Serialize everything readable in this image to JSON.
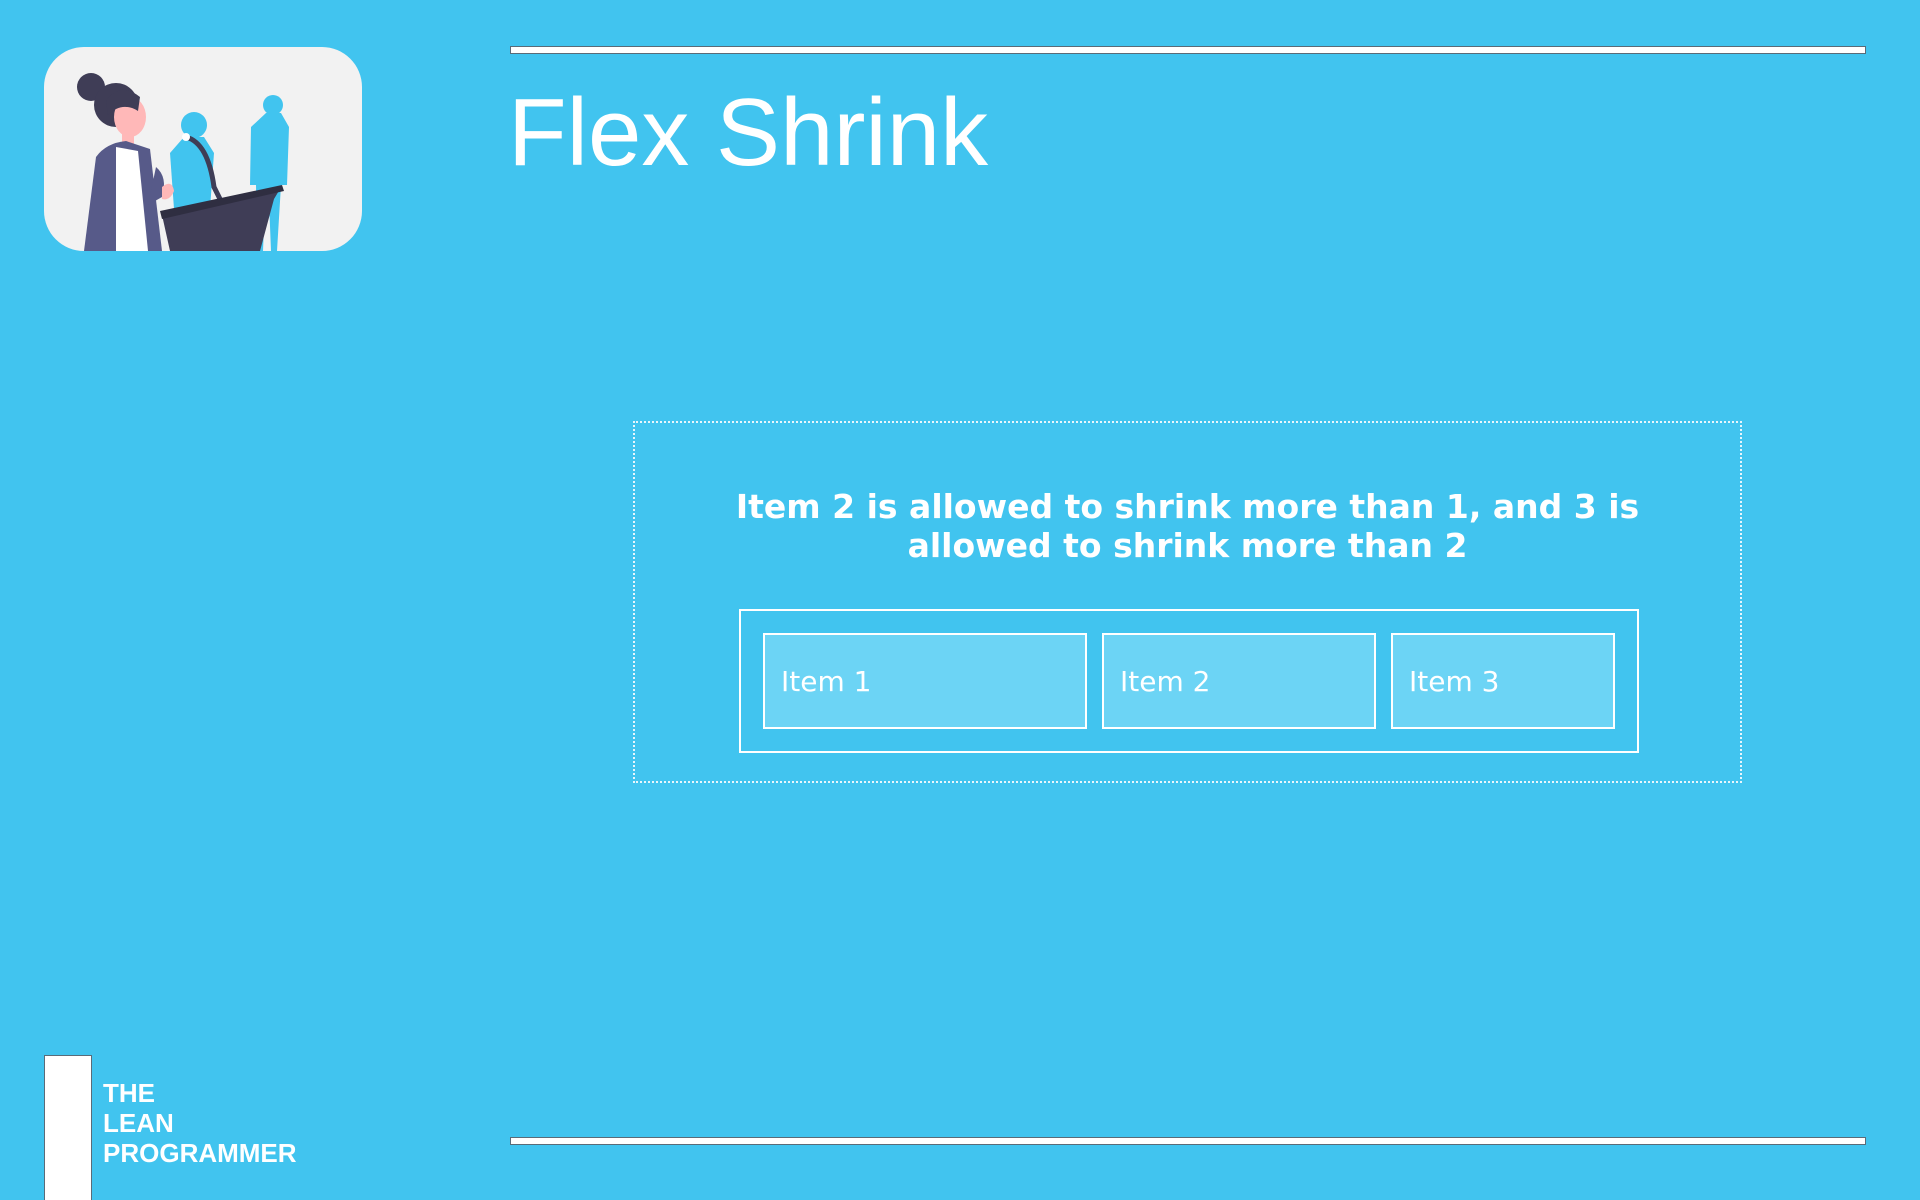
{
  "slide": {
    "title": "Flex Shrink",
    "background_color": "#41c4ef"
  },
  "illustration": {
    "name": "presenter-at-podium"
  },
  "demo": {
    "caption": "Item 2 is allowed to shrink more than 1, and 3 is allowed to shrink more than 2",
    "items": [
      {
        "label": "Item 1"
      },
      {
        "label": "Item 2"
      },
      {
        "label": "Item 3"
      }
    ]
  },
  "brand": {
    "lines": [
      "THE",
      "LEAN",
      "PROGRAMMER"
    ]
  }
}
